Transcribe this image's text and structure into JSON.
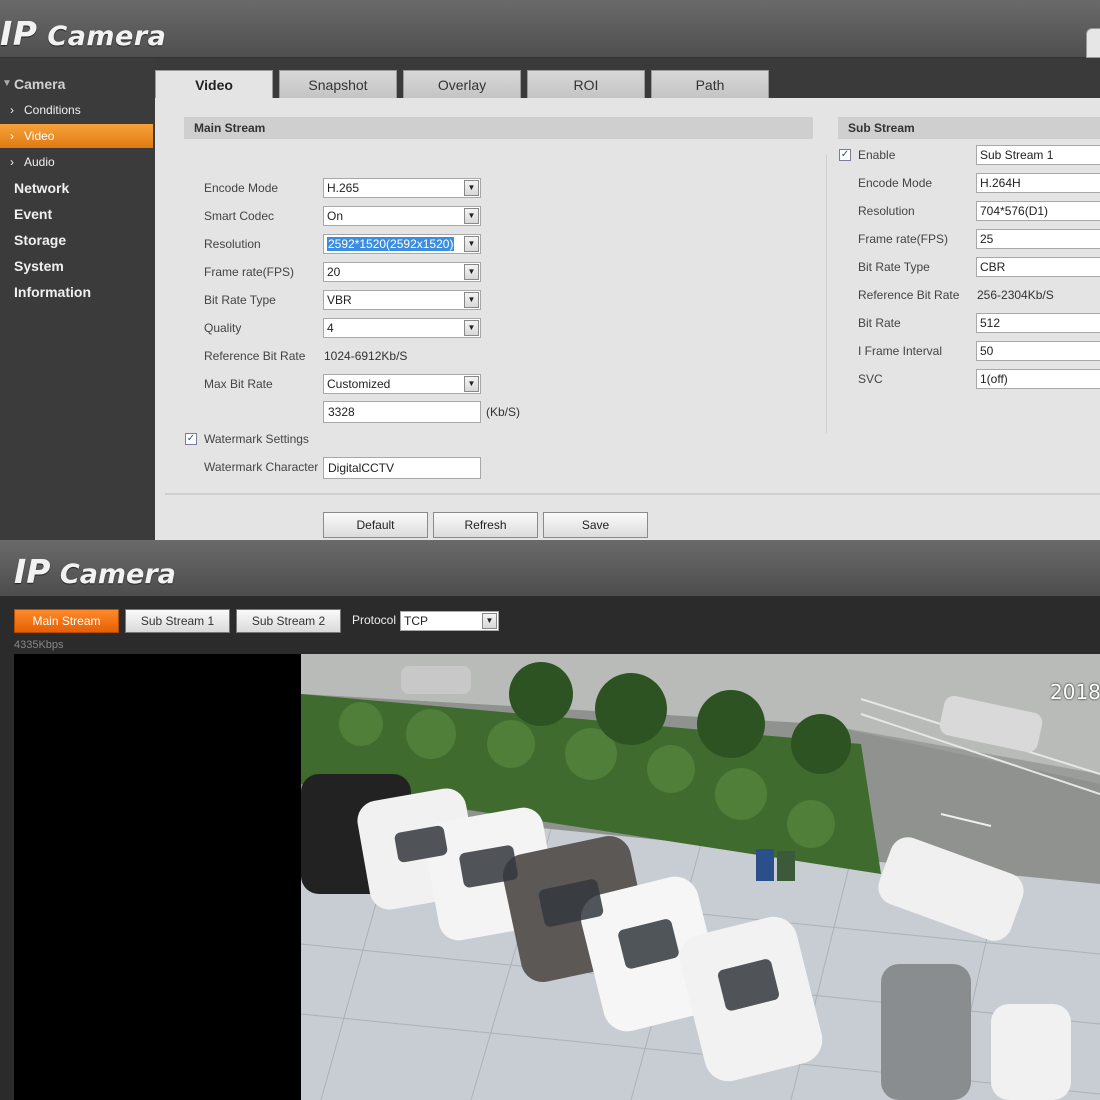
{
  "app": {
    "brand_ip": "IP",
    "brand_camera": "Camera"
  },
  "sidebar": {
    "camera": "Camera",
    "conditions": "Conditions",
    "video": "Video",
    "audio": "Audio",
    "network": "Network",
    "event": "Event",
    "storage": "Storage",
    "system": "System",
    "information": "Information"
  },
  "tabs": {
    "video": "Video",
    "snapshot": "Snapshot",
    "overlay": "Overlay",
    "roi": "ROI",
    "path": "Path"
  },
  "main_stream": {
    "title": "Main Stream",
    "encode_mode_label": "Encode Mode",
    "encode_mode": "H.265",
    "smart_codec_label": "Smart Codec",
    "smart_codec": "On",
    "resolution_label": "Resolution",
    "resolution": "2592*1520(2592x1520)",
    "frame_rate_label": "Frame rate(FPS)",
    "frame_rate": "20",
    "bit_rate_type_label": "Bit Rate Type",
    "bit_rate_type": "VBR",
    "quality_label": "Quality",
    "quality": "4",
    "ref_bit_rate_label": "Reference Bit Rate",
    "ref_bit_rate": "1024-6912Kb/S",
    "max_bit_rate_label": "Max Bit Rate",
    "max_bit_rate": "Customized",
    "max_bit_rate_value": "3328",
    "unit": "(Kb/S)",
    "watermark_settings_label": "Watermark Settings",
    "watermark_char_label": "Watermark Character",
    "watermark_char": "DigitalCCTV"
  },
  "sub_stream": {
    "title": "Sub Stream",
    "enable_label": "Enable",
    "stream": "Sub Stream 1",
    "encode_mode_label": "Encode Mode",
    "encode_mode": "H.264H",
    "resolution_label": "Resolution",
    "resolution": "704*576(D1)",
    "frame_rate_label": "Frame rate(FPS)",
    "frame_rate": "25",
    "bit_rate_type_label": "Bit Rate Type",
    "bit_rate_type": "CBR",
    "ref_bit_rate_label": "Reference Bit Rate",
    "ref_bit_rate": "256-2304Kb/S",
    "bit_rate_label": "Bit Rate",
    "bit_rate": "512",
    "iframe_label": "I Frame Interval",
    "iframe": "50",
    "svc_label": "SVC",
    "svc": "1(off)"
  },
  "buttons": {
    "default": "Default",
    "refresh": "Refresh",
    "save": "Save"
  },
  "live": {
    "main_stream": "Main Stream",
    "sub_stream_1": "Sub Stream 1",
    "sub_stream_2": "Sub Stream 2",
    "protocol_label": "Protocol",
    "protocol": "TCP",
    "bitrate": "4335Kbps",
    "osd_date": "2018"
  },
  "colors": {
    "accent": "#f28a1e",
    "active_stream": "#e8650a",
    "panel_bg": "#e4e4e4"
  }
}
